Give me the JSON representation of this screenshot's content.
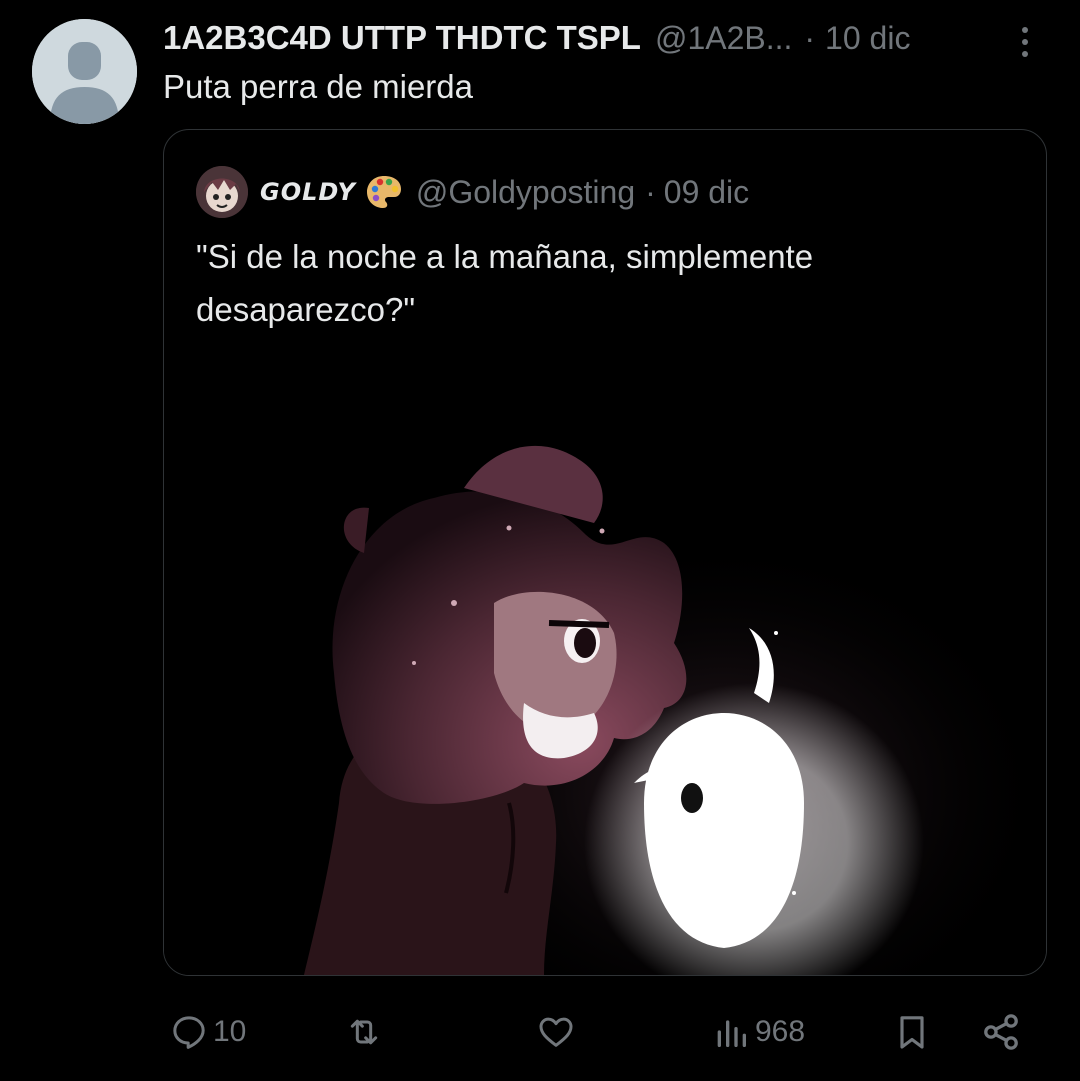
{
  "post": {
    "display_name": "1A2B3C4D UTTP THDTC TSPL",
    "handle": "@1A2B...",
    "separator": "·",
    "date": "10 dic",
    "text": "Puta perra de mierda",
    "avatar_icon": "default-avatar-icon",
    "more_icon": "more-vertical-icon"
  },
  "quote": {
    "display_name": "GOLDY",
    "name_emoji": "artist-palette-icon",
    "handle": "@Goldyposting",
    "separator": "·",
    "date": "09 dic",
    "text": "\"Si de la noche a la mañana, simplemente desaparezco?\"",
    "media_description_icon": "illustration-image"
  },
  "actions": {
    "reply": {
      "icon": "reply-icon",
      "count": "10"
    },
    "repost": {
      "icon": "repost-icon",
      "count": ""
    },
    "like": {
      "icon": "like-icon",
      "count": ""
    },
    "views": {
      "icon": "views-icon",
      "count": "968"
    },
    "bookmark": {
      "icon": "bookmark-icon"
    },
    "share": {
      "icon": "share-icon"
    }
  },
  "colors": {
    "background": "#000000",
    "primary_text": "#e7e9ea",
    "secondary_text": "#71767b",
    "border": "#2f3336",
    "avatar_bg": "#cfd9de",
    "avatar_fg": "#8899a6"
  }
}
